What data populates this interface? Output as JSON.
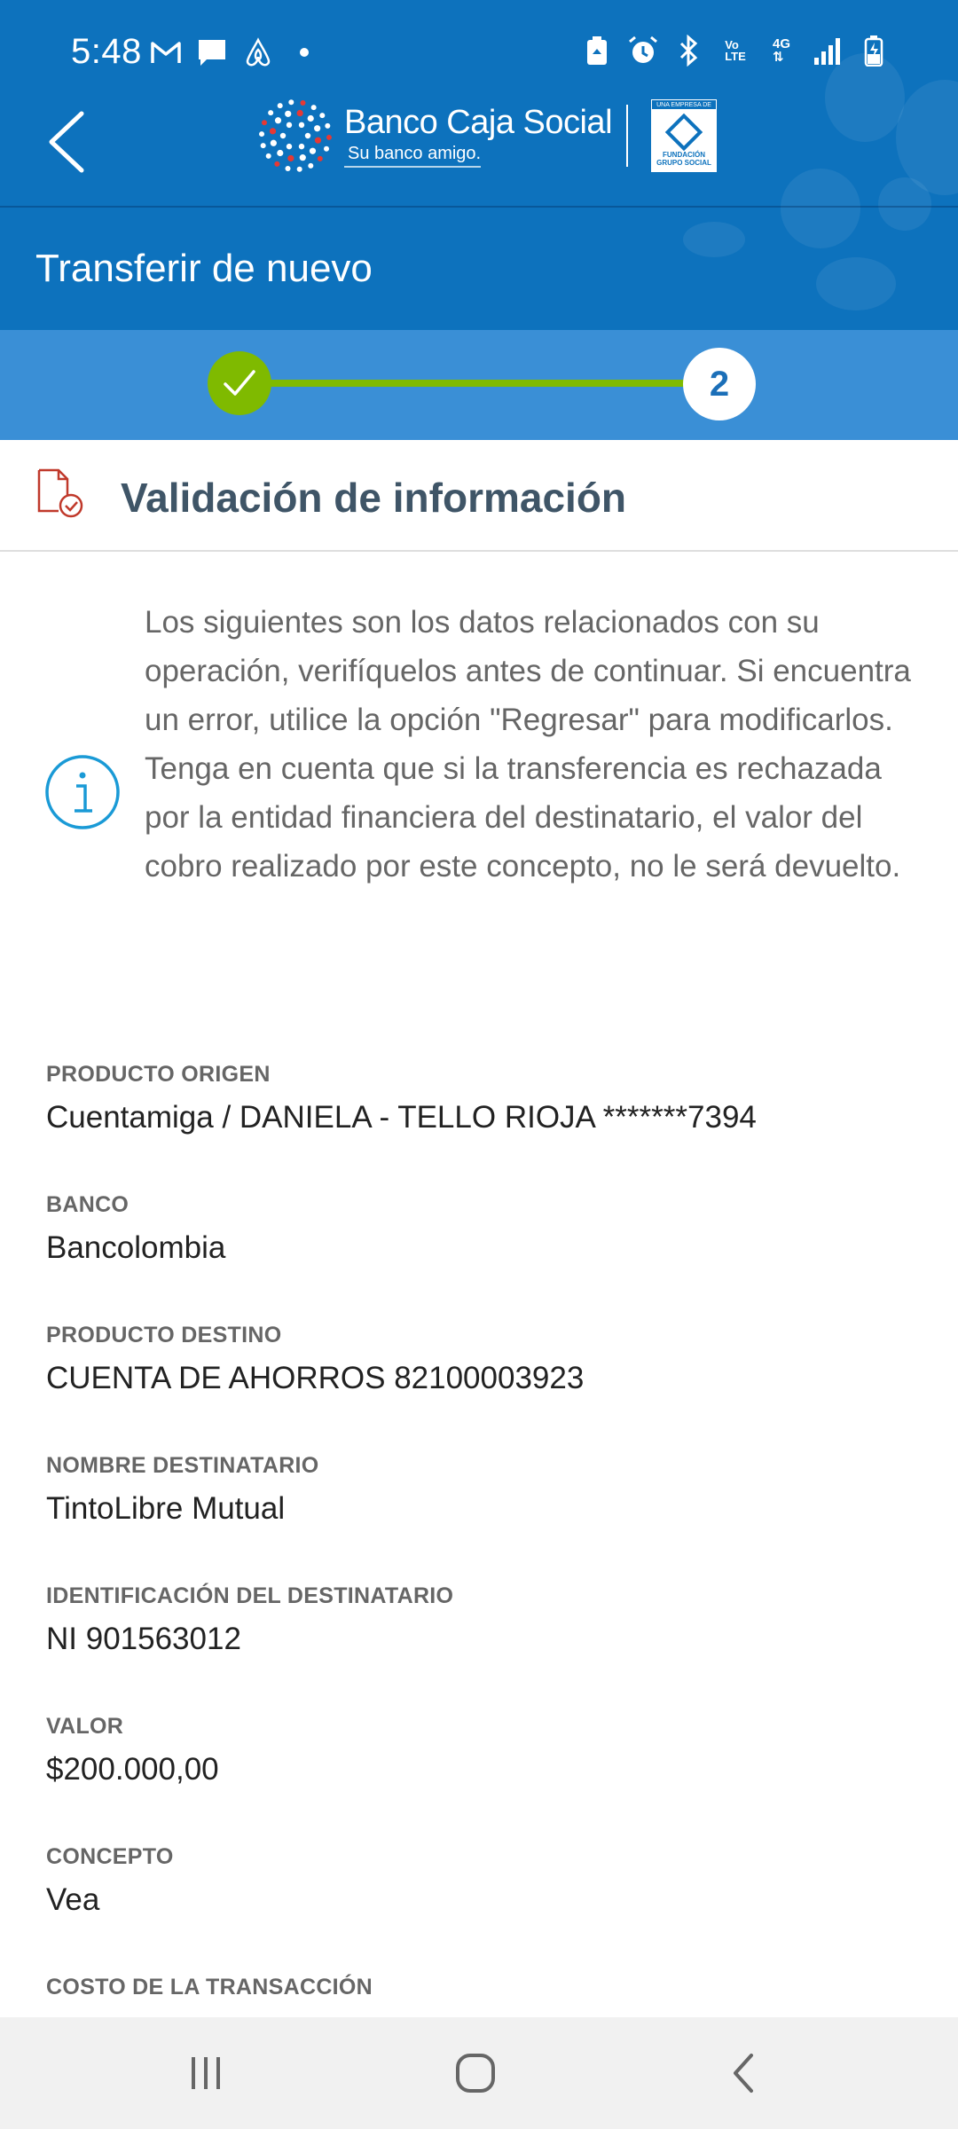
{
  "status_bar": {
    "time": "5:48",
    "left_icons": [
      "gmail-icon",
      "chat-icon",
      "airbnb-icon",
      "dot-icon"
    ],
    "right_icons": [
      "battery-saver-icon",
      "alarm-icon",
      "bluetooth-icon",
      "volte-icon",
      "4g-icon",
      "signal-icon",
      "battery-icon"
    ]
  },
  "header": {
    "brand_name": "Banco Caja Social",
    "brand_tagline": "Su banco amigo.",
    "fund_top_text": "UNA EMPRESA DE",
    "fund_name_line1": "FUNDACIÓN",
    "fund_name_line2": "GRUPO SOCIAL",
    "page_title": "Transferir de nuevo",
    "colors": {
      "primary": "#0d72bd",
      "stepper_bg": "#3a8fd6",
      "step_done": "#7fba00"
    }
  },
  "stepper": {
    "current_step": "2",
    "done_icon": "check-icon"
  },
  "section": {
    "title": "Validación de información",
    "icon": "document-check-icon"
  },
  "info": {
    "icon": "info-icon",
    "paragraph1": "Los siguientes son los datos relacionados con su operación, verifíquelos antes de continuar. Si encuentra un error, utilice la opción \"Regresar\" para modificarlos.",
    "paragraph2": "Tenga en cuenta que si la transferencia es rechazada por la entidad financiera del destinatario, el valor del cobro realizado por este concepto, no le será devuelto."
  },
  "fields": [
    {
      "label": "PRODUCTO ORIGEN",
      "value": "Cuentamiga / DANIELA - TELLO RIOJA *******7394"
    },
    {
      "label": "BANCO",
      "value": "Bancolombia"
    },
    {
      "label": "PRODUCTO DESTINO",
      "value": "CUENTA DE AHORROS 82100003923"
    },
    {
      "label": "NOMBRE DESTINATARIO",
      "value": "TintoLibre Mutual"
    },
    {
      "label": "IDENTIFICACIÓN DEL DESTINATARIO",
      "value": "NI 901563012"
    },
    {
      "label": "VALOR",
      "value": "$200.000,00"
    },
    {
      "label": "CONCEPTO",
      "value": "Vea"
    },
    {
      "label": "COSTO DE LA TRANSACCIÓN",
      "value": ""
    }
  ],
  "nav": {
    "recents": "recents-icon",
    "home": "home-icon",
    "back": "back-icon"
  }
}
